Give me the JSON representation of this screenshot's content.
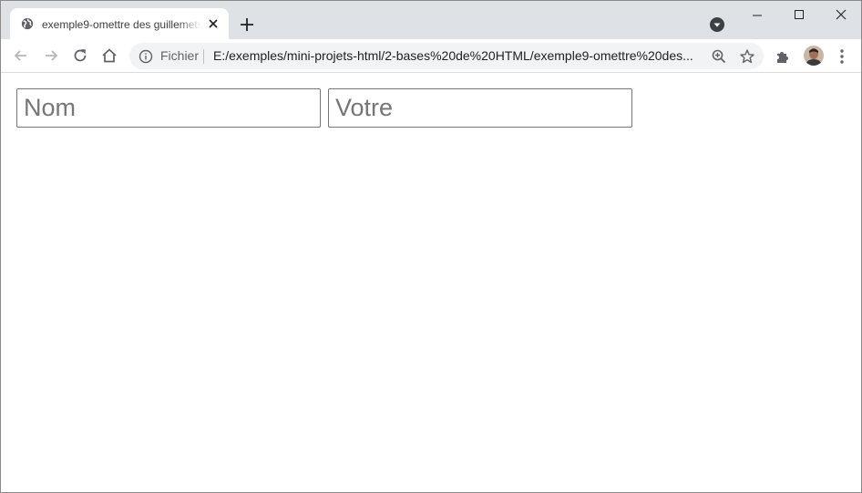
{
  "browser": {
    "tab": {
      "title": "exemple9-omettre des guillemets",
      "favicon": "globe-icon"
    },
    "omnibox": {
      "scheme_label": "Fichier",
      "url": "E:/exemples/mini-projets-html/2-bases%20de%20HTML/exemple9-omettre%20des..."
    },
    "icons": {
      "back": "arrow-left-icon",
      "forward": "arrow-right-icon",
      "reload": "reload-icon",
      "home": "home-icon",
      "info": "info-icon",
      "zoom": "zoom-icon",
      "star": "star-icon",
      "extensions": "puzzle-icon",
      "menu": "kebab-menu-icon"
    }
  },
  "page": {
    "inputs": [
      {
        "placeholder": "Nom",
        "value": ""
      },
      {
        "placeholder": "Votre",
        "value": ""
      }
    ]
  },
  "colors": {
    "tabstrip_bg": "#dee1e6",
    "omnibox_bg": "#f1f3f4",
    "input_border": "#767676"
  }
}
